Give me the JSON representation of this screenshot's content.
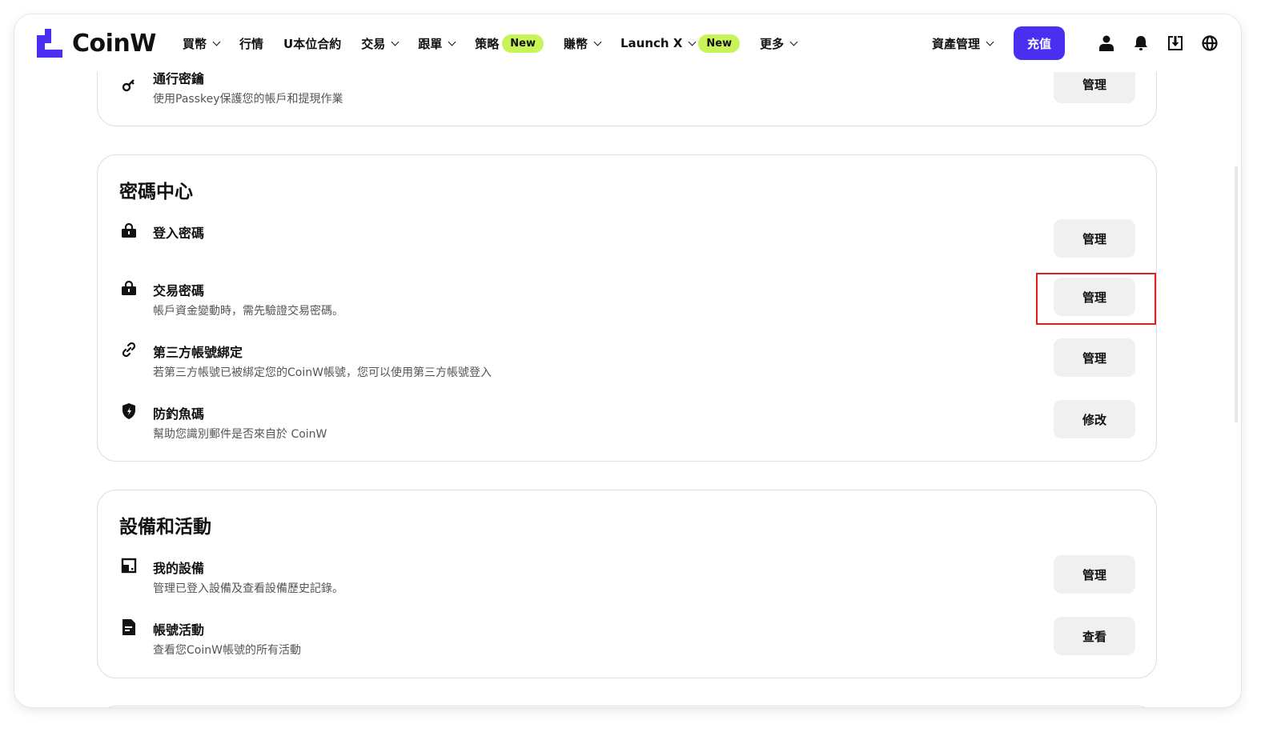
{
  "header": {
    "logo_text": "CoinW",
    "brand_color": "#4a2ff0",
    "nav": [
      {
        "label": "買幣",
        "dropdown": true
      },
      {
        "label": "行情",
        "dropdown": false
      },
      {
        "label": "U本位合約",
        "dropdown": false
      },
      {
        "label": "交易",
        "dropdown": true
      },
      {
        "label": "跟單",
        "dropdown": true
      },
      {
        "label": "策略",
        "badge": "New",
        "dropdown": false
      },
      {
        "label": "賺幣",
        "dropdown": true
      },
      {
        "label": "Launch X",
        "badge": "New",
        "dropdown": true
      },
      {
        "label": "更多",
        "dropdown": true
      }
    ],
    "asset_management": "資產管理",
    "deposit_button": "充值",
    "icons": [
      "user-icon",
      "bell-icon",
      "download-icon",
      "globe-icon"
    ]
  },
  "passkey_card": {
    "title": "通行密鑰",
    "desc": "使用Passkey保護您的帳戶和提現作業",
    "button": "管理",
    "icon": "key-icon"
  },
  "password_center": {
    "title": "密碼中心",
    "rows": [
      {
        "title": "登入密碼",
        "desc": "",
        "button": "管理",
        "icon": "lock-icon"
      },
      {
        "title": "交易密碼",
        "desc": "帳戶資金變動時，需先驗證交易密碼。",
        "button": "管理",
        "icon": "lock-icon"
      },
      {
        "title": "第三方帳號綁定",
        "desc": "若第三方帳號已被綁定您的CoinW帳號，您可以使用第三方帳號登入",
        "button": "管理",
        "icon": "link-icon"
      },
      {
        "title": "防釣魚碼",
        "desc": "幫助您識別郵件是否來自於 CoinW",
        "button": "修改",
        "icon": "shield-icon"
      }
    ]
  },
  "devices": {
    "title": "設備和活動",
    "rows": [
      {
        "title": "我的設備",
        "desc": "管理已登入設備及查看設備歷史記錄。",
        "button": "管理",
        "icon": "device-icon"
      },
      {
        "title": "帳號活動",
        "desc": "查看您CoinW帳號的所有活動",
        "button": "查看",
        "icon": "document-icon"
      }
    ]
  },
  "highlight_color": "#e0201f"
}
